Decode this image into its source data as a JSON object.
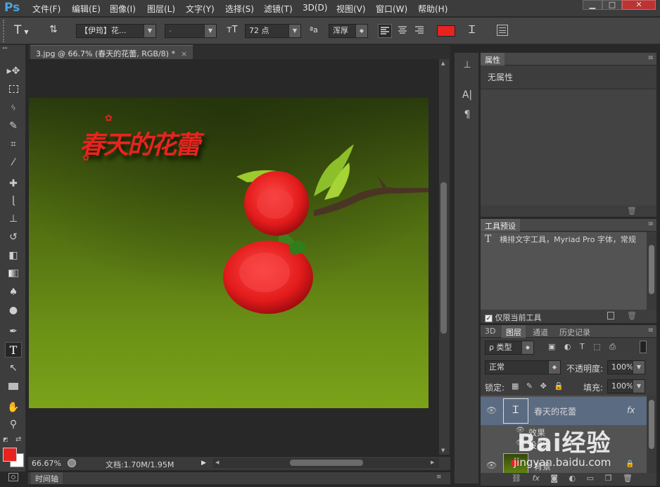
{
  "app": {
    "logo": "Ps"
  },
  "menu": [
    "文件(F)",
    "编辑(E)",
    "图像(I)",
    "图层(L)",
    "文字(Y)",
    "选择(S)",
    "滤镜(T)",
    "3D(D)",
    "视图(V)",
    "窗口(W)",
    "帮助(H)"
  ],
  "window_controls": {
    "minimize": "▁",
    "maximize": "□",
    "close": "✕"
  },
  "options": {
    "tool_glyph": "T",
    "font_family": "【伊筠】花...",
    "font_style": "-",
    "font_size": "72 点",
    "aa_label": "ªa",
    "antialias": "浑厚",
    "text_color": "#e8231f"
  },
  "document": {
    "tab_title": "3.jpg @ 66.7% (春天的花蕾, RGB/8) *",
    "tab_close": "×",
    "photo_text": "春天的花蕾",
    "zoom": "66.67%",
    "doc_info": "文档:1.70M/1.95M"
  },
  "timeline": {
    "label": "时间轴"
  },
  "properties": {
    "title": "属性",
    "body": "无属性"
  },
  "tool_presets": {
    "title": "工具预设",
    "item": "横排文字工具，Myriad Pro 字体，常规",
    "only_current_label": "仅限当前工具"
  },
  "layers_panel": {
    "tabs": [
      "3D",
      "图层",
      "通道",
      "历史记录"
    ],
    "active_tab": "图层",
    "filter_type": "ρ 类型",
    "blend_mode": "正常",
    "opacity_label": "不透明度:",
    "opacity_value": "100%",
    "lock_label": "锁定:",
    "fill_label": "填充:",
    "fill_value": "100%",
    "layers": [
      {
        "name": "春天的花蕾",
        "fx": "fx",
        "selected": true
      },
      {
        "name": "效果",
        "sub": true
      },
      {
        "name": "投影",
        "sub": true
      },
      {
        "name": "背景",
        "locked": true
      }
    ]
  },
  "watermark": {
    "brand": "Bai经验",
    "url": "jingyan.baidu.com"
  }
}
